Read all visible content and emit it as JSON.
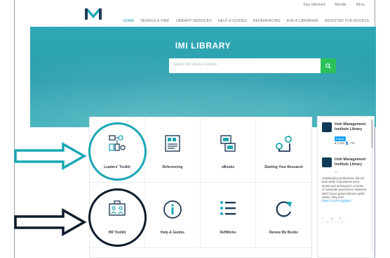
{
  "utility_links": [
    "Stay Informed",
    "Moodle",
    "IMI.ie"
  ],
  "main_nav": [
    {
      "label": "HOME",
      "active": true
    },
    {
      "label": "SEARCH & FIND",
      "active": false
    },
    {
      "label": "LIBRARY SERVICES",
      "active": false
    },
    {
      "label": "HELP & GUIDES",
      "active": false
    },
    {
      "label": "REFERENCING",
      "active": false
    },
    {
      "label": "ASK A LIBRARIAN",
      "active": false
    },
    {
      "label": "REGISTER FOR ACCESS",
      "active": false
    }
  ],
  "hero": {
    "title": "IMI LIBRARY",
    "search_placeholder": "Search the Library collection",
    "search_icon": "search-icon"
  },
  "tiles": [
    {
      "label": "Leaders' Toolkit",
      "icon": "leaders-toolkit-icon"
    },
    {
      "label": "Referencing",
      "icon": "referencing-quote-icon"
    },
    {
      "label": "eBooks",
      "icon": "ebooks-device-icon"
    },
    {
      "label": "Starting Your Research",
      "icon": "research-route-icon"
    },
    {
      "label": "HR Toolkit",
      "icon": "hr-toolkit-icon"
    },
    {
      "label": "Help & Guides",
      "icon": "info-icon"
    },
    {
      "label": "RefWorks",
      "icon": "list-icon"
    },
    {
      "label": "Renew My Books",
      "icon": "renew-arrow-icon"
    }
  ],
  "twitter": {
    "account_name": "Irish Management Institute Library",
    "follow_label": "Follow",
    "stats": "♥ 1,402  👤 715",
    "tweet_author": "Irish Management Institute Library",
    "tweet_date": "2h",
    "tweet_text": "Gatekeeping professions did not bark while corporations were looted and destroyed in a series of corporate governance disasters which have gained almost mythic status. Why not?",
    "tweet_link": "https://t.co/6YvQjjxb53",
    "tweet_actions": "↩ ⇄ ♥ Twitter"
  },
  "colors": {
    "accent": "#1a9bb0",
    "hero": "#2fa8b5",
    "search_button": "#2cc25a",
    "highlight_teal": "#1aa7b4",
    "highlight_dark": "#0d1b2a"
  }
}
